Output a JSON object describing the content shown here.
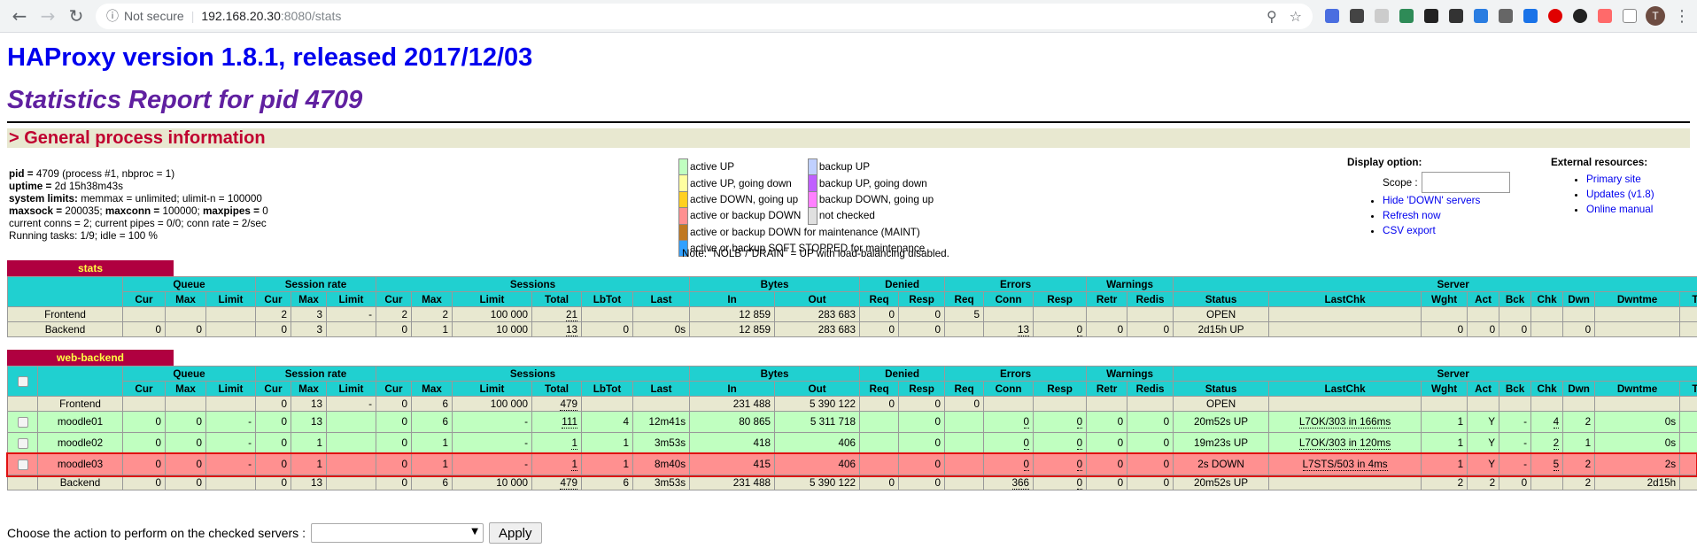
{
  "browser": {
    "not_secure": "Not secure",
    "url_host": "192.168.20.30",
    "url_path": ":8080/stats",
    "avatar_initial": "T"
  },
  "header": {
    "title": "HAProxy version 1.8.1, released 2017/12/03",
    "subtitle": "Statistics Report for pid 4709",
    "section": "> General process information"
  },
  "process": {
    "line1_label": "pid = ",
    "line1_value": "4709 (process #1, nbproc = 1)",
    "line2_label": "uptime = ",
    "line2_value": "2d 15h38m43s",
    "line3_label": "system limits:",
    "line3_value": " memmax = unlimited; ulimit-n = 100000",
    "line4_label1": "maxsock = ",
    "line4_value1": "200035; ",
    "line4_label2": "maxconn = ",
    "line4_value2": "100000; ",
    "line4_label3": "maxpipes = ",
    "line4_value3": "0",
    "line5": "current conns = 2; current pipes = 0/0; conn rate = 2/sec",
    "line6": "Running tasks: 1/9; idle = 100 %"
  },
  "legend": {
    "active_up": "active UP",
    "backup_up": "backup UP",
    "active_up_going_down": "active UP, going down",
    "backup_up_going_down": "backup UP, going down",
    "active_down_going_up": "active DOWN, going up",
    "backup_down_going_up": "backup DOWN, going up",
    "active_or_backup_down": "active or backup DOWN",
    "not_checked": "not checked",
    "maint": "active or backup DOWN for maintenance (MAINT)",
    "soft_stopped": "active or backup SOFT STOPPED for maintenance",
    "note": "Note: \"NOLB\"/\"DRAIN\" = UP with load-balancing disabled."
  },
  "display_options": {
    "title": "Display option:",
    "scope_label": "Scope :",
    "hide_down": "Hide 'DOWN' servers",
    "refresh": "Refresh now",
    "csv": "CSV export"
  },
  "external": {
    "title": "External resources:",
    "primary": "Primary site",
    "updates": "Updates (v1.8)",
    "manual": "Online manual"
  },
  "headers": {
    "queue": "Queue",
    "session_rate": "Session rate",
    "sessions": "Sessions",
    "bytes": "Bytes",
    "denied": "Denied",
    "errors": "Errors",
    "warnings": "Warnings",
    "server": "Server",
    "cur": "Cur",
    "max": "Max",
    "limit": "Limit",
    "total": "Total",
    "lbtot": "LbTot",
    "last": "Last",
    "in": "In",
    "out": "Out",
    "req": "Req",
    "resp": "Resp",
    "conn": "Conn",
    "retr": "Retr",
    "redis": "Redis",
    "status": "Status",
    "lastchk": "LastChk",
    "wght": "Wght",
    "act": "Act",
    "bck": "Bck",
    "chk": "Chk",
    "dwn": "Dwn",
    "dwntme": "Dwntme",
    "thrtle": "Thrtle"
  },
  "stats": {
    "name": "stats",
    "frontend": [
      "Frontend",
      "",
      "",
      "",
      "2",
      "3",
      "-",
      "2",
      "2",
      "100 000",
      "21",
      "",
      "",
      "12 859",
      "283 683",
      "0",
      "0",
      "5",
      "",
      "",
      "",
      "",
      "OPEN",
      "",
      "",
      "",
      "",
      "",
      "",
      "",
      ""
    ],
    "backend": [
      "Backend",
      "0",
      "0",
      "",
      "0",
      "3",
      "",
      "0",
      "1",
      "10 000",
      "13",
      "0",
      "0s",
      "12 859",
      "283 683",
      "0",
      "0",
      "",
      "13",
      "0",
      "0",
      "0",
      "2d15h UP",
      "",
      "0",
      "0",
      "0",
      "",
      "0",
      "",
      ""
    ]
  },
  "web_backend": {
    "name": "web-backend",
    "frontend": [
      "Frontend",
      "",
      "",
      "",
      "0",
      "13",
      "-",
      "0",
      "6",
      "100 000",
      "479",
      "",
      "",
      "231 488",
      "5 390 122",
      "0",
      "0",
      "0",
      "",
      "",
      "",
      "",
      "OPEN",
      "",
      "",
      "",
      "",
      "",
      "",
      "",
      ""
    ],
    "servers": [
      [
        "moodle01",
        "0",
        "0",
        "-",
        "0",
        "13",
        "",
        "0",
        "6",
        "-",
        "111",
        "4",
        "12m41s",
        "80 865",
        "5 311 718",
        "",
        "0",
        "",
        "0",
        "0",
        "0",
        "0",
        "20m52s UP",
        "L7OK/303 in 166ms",
        "1",
        "Y",
        "-",
        "4",
        "2",
        "0s",
        "-"
      ],
      [
        "moodle02",
        "0",
        "0",
        "-",
        "0",
        "1",
        "",
        "0",
        "1",
        "-",
        "1",
        "1",
        "3m53s",
        "418",
        "406",
        "",
        "0",
        "",
        "0",
        "0",
        "0",
        "0",
        "19m23s UP",
        "L7OK/303 in 120ms",
        "1",
        "Y",
        "-",
        "2",
        "1",
        "0s",
        "-"
      ],
      [
        "moodle03",
        "0",
        "0",
        "-",
        "0",
        "1",
        "",
        "0",
        "1",
        "-",
        "1",
        "1",
        "8m40s",
        "415",
        "406",
        "",
        "0",
        "",
        "0",
        "0",
        "0",
        "0",
        "2s DOWN",
        "L7STS/503 in 4ms",
        "1",
        "Y",
        "-",
        "5",
        "2",
        "2s",
        "-"
      ]
    ],
    "backend": [
      "Backend",
      "0",
      "0",
      "",
      "0",
      "13",
      "",
      "0",
      "6",
      "10 000",
      "479",
      "6",
      "3m53s",
      "231 488",
      "5 390 122",
      "0",
      "0",
      "",
      "366",
      "0",
      "0",
      "0",
      "20m52s UP",
      "",
      "2",
      "2",
      "0",
      "",
      "2",
      "2d15h",
      ""
    ]
  },
  "action": {
    "label": "Choose the action to perform on the checked servers :",
    "apply": "Apply"
  },
  "colors": {
    "header_cyan": "#20d0d0",
    "frontend_bg": "#e8e8d0",
    "up_bg": "#c0ffc0",
    "down_bg": "#ff9090",
    "title_blue": "#0000ee",
    "subtitle_purple": "#6020a0",
    "section_red": "#c00030"
  }
}
